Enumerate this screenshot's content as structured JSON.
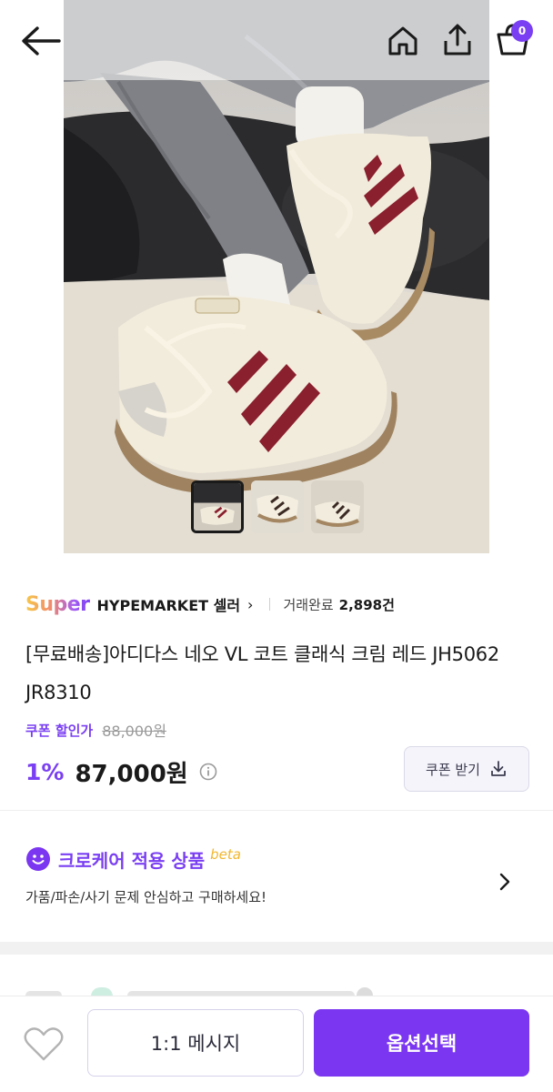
{
  "header": {
    "back_icon": "arrow-left-icon",
    "home_icon": "home-icon",
    "share_icon": "share-icon",
    "cart_icon": "shopping-bag-icon",
    "cart_count": "0"
  },
  "gallery": {
    "thumbnail_count": 3,
    "active_index": 0
  },
  "seller": {
    "badge": "Super",
    "name": "HYPEMARKET 셀러",
    "chevron": "›",
    "trade_label": "거래완료",
    "trade_count": "2,898건"
  },
  "product": {
    "title": "[무료배송]아디다스 네오 VL 코트 클래식 크림 레드 JH5062 JR8310",
    "coupon_label": "쿠폰 할인가",
    "original_price": "88,000원",
    "discount": "1%",
    "price": "87,000원",
    "coupon_button": "쿠폰 받기"
  },
  "care": {
    "title": "크로케어 적용 상품",
    "beta": "beta",
    "description": "가품/파손/사기 문제 안심하고 구매하세요!"
  },
  "bottom_bar": {
    "message_button": "1:1 메시지",
    "option_button": "옵션선택"
  },
  "colors": {
    "accent": "#7a36f0",
    "beta": "#f2b730"
  }
}
